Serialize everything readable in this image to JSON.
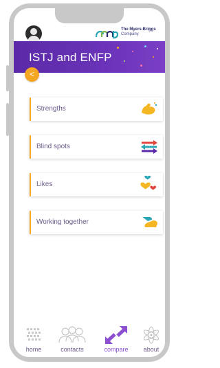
{
  "header": {
    "avatar_icon": "user-avatar-icon",
    "brand": {
      "line1": "The Myers-Briggs",
      "line2": "Company"
    },
    "title": "ISTJ and ENFP",
    "back_icon": "chevron-left-icon",
    "back_label": "<"
  },
  "cards": [
    {
      "label": "Strengths",
      "icon": "flexed-arm-icon"
    },
    {
      "label": "Blind spots",
      "icon": "crossing-arrows-icon"
    },
    {
      "label": "Likes",
      "icon": "hearts-icon"
    },
    {
      "label": "Working together",
      "icon": "handshake-icon"
    }
  ],
  "nav": {
    "items": [
      {
        "label": "home",
        "icon": "home-pattern-icon",
        "active": false
      },
      {
        "label": "contacts",
        "icon": "contacts-icon",
        "active": false
      },
      {
        "label": "compare",
        "icon": "compare-arrows-icon",
        "active": true
      },
      {
        "label": "about",
        "icon": "atom-icon",
        "active": false
      }
    ]
  },
  "colors": {
    "banner": "#6a33b8",
    "accent": "#f5a623",
    "nav_active": "#8b4fd0",
    "text": "#6b5a8a"
  }
}
